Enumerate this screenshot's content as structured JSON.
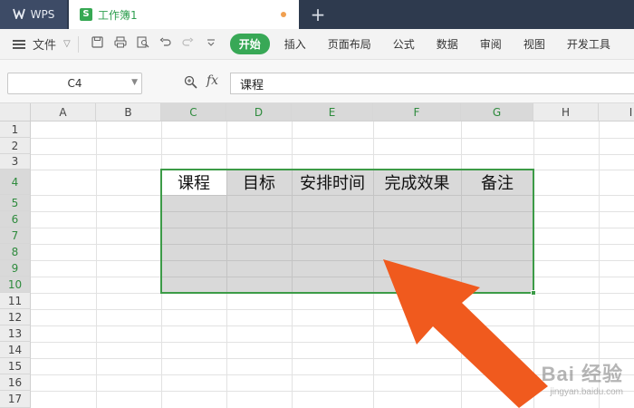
{
  "titlebar": {
    "app_tab_label": "WPS",
    "doc_tab_label": "工作簿1",
    "doc_icon_letter": "S",
    "new_tab_symbol": "+"
  },
  "menubar": {
    "file_label": "文件",
    "start_label": "开始",
    "items": [
      "插入",
      "页面布局",
      "公式",
      "数据",
      "审阅",
      "视图",
      "开发工具"
    ]
  },
  "formulabar": {
    "cell_ref": "C4",
    "fx_label": "fx",
    "formula_value": "课程"
  },
  "grid": {
    "columns": [
      "A",
      "B",
      "C",
      "D",
      "E",
      "F",
      "G",
      "H",
      "I"
    ],
    "rows": [
      "1",
      "2",
      "3",
      "4",
      "5",
      "6",
      "7",
      "8",
      "9",
      "10",
      "11",
      "12",
      "13",
      "14",
      "15",
      "16",
      "17"
    ],
    "selected_columns": [
      "C",
      "D",
      "E",
      "F",
      "G"
    ],
    "selected_rows": [
      "4",
      "5",
      "6",
      "7",
      "8",
      "9",
      "10"
    ],
    "header_row_cells": [
      "课程",
      "目标",
      "安排时间",
      "完成效果",
      "备注"
    ]
  },
  "colors": {
    "accent_green": "#38a856",
    "selection_fill": "#d9d9d9",
    "arrow_orange": "#f05a1e",
    "titlebar_dark": "#2e3a4e"
  },
  "watermark": {
    "brand": "Bai 经验",
    "url": "jingyan.baidu.com"
  }
}
